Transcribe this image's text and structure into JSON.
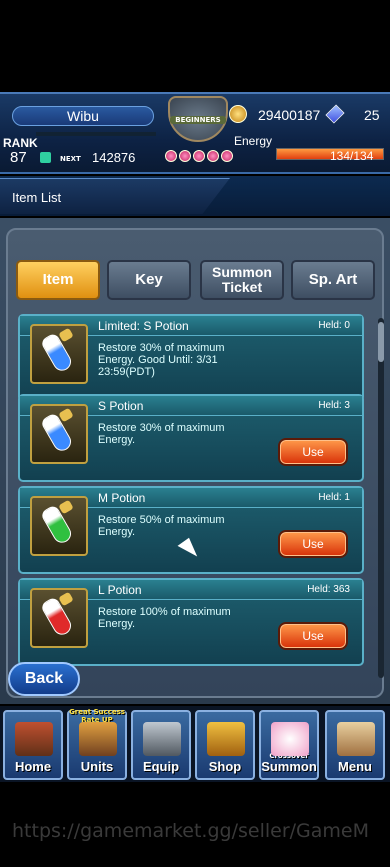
{
  "header": {
    "player_name": "Wibu",
    "rank_label": "RANK",
    "rank_value": "87",
    "next_label": "NEXT",
    "next_value": "142876",
    "emblem_text": "BEGINNERS",
    "money": "29400187",
    "crystals": "25",
    "energy_label": "Energy",
    "energy_value": "134/134",
    "energy_fraction": 1.0
  },
  "section": {
    "title": "Item List"
  },
  "tabs": [
    {
      "label": "Item",
      "active": true
    },
    {
      "label": "Key",
      "active": false
    },
    {
      "label_line1": "Summon",
      "label_line2": "Ticket",
      "active": false
    },
    {
      "label": "Sp. Art",
      "active": false
    }
  ],
  "items": [
    {
      "name": "Limited: S Potion",
      "held": "Held: 0",
      "desc_line1": "Restore 30% of maximum",
      "desc_line2": "Energy. Good Until: 3/31",
      "desc_line3": "23:59(PDT)",
      "color": "#3a8aff",
      "has_use": false
    },
    {
      "name": "S Potion",
      "held": "Held: 3",
      "desc_line1": "Restore 30% of maximum",
      "desc_line2": "Energy.",
      "desc_line3": "",
      "color": "#3a8aff",
      "has_use": true,
      "use_label": "Use"
    },
    {
      "name": "M Potion",
      "held": "Held: 1",
      "desc_line1": "Restore 50% of maximum",
      "desc_line2": "Energy.",
      "desc_line3": "",
      "color": "#30c040",
      "has_use": true,
      "use_label": "Use"
    },
    {
      "name": "L Potion",
      "held": "Held: 363",
      "desc_line1": "Restore 100% of maximum",
      "desc_line2": "Energy.",
      "desc_line3": "",
      "color": "#e02a2a",
      "has_use": true,
      "use_label": "Use"
    }
  ],
  "back_label": "Back",
  "nav": [
    {
      "label": "Home",
      "badge": ""
    },
    {
      "label": "Units",
      "badge": "Great Success Rate UP"
    },
    {
      "label": "Equip",
      "badge": ""
    },
    {
      "label": "Shop",
      "badge": ""
    },
    {
      "label": "Summon",
      "badge": "Crossover"
    },
    {
      "label": "Menu",
      "badge": ""
    }
  ],
  "watermark": "https://gamemarket.gg/seller/GameM"
}
